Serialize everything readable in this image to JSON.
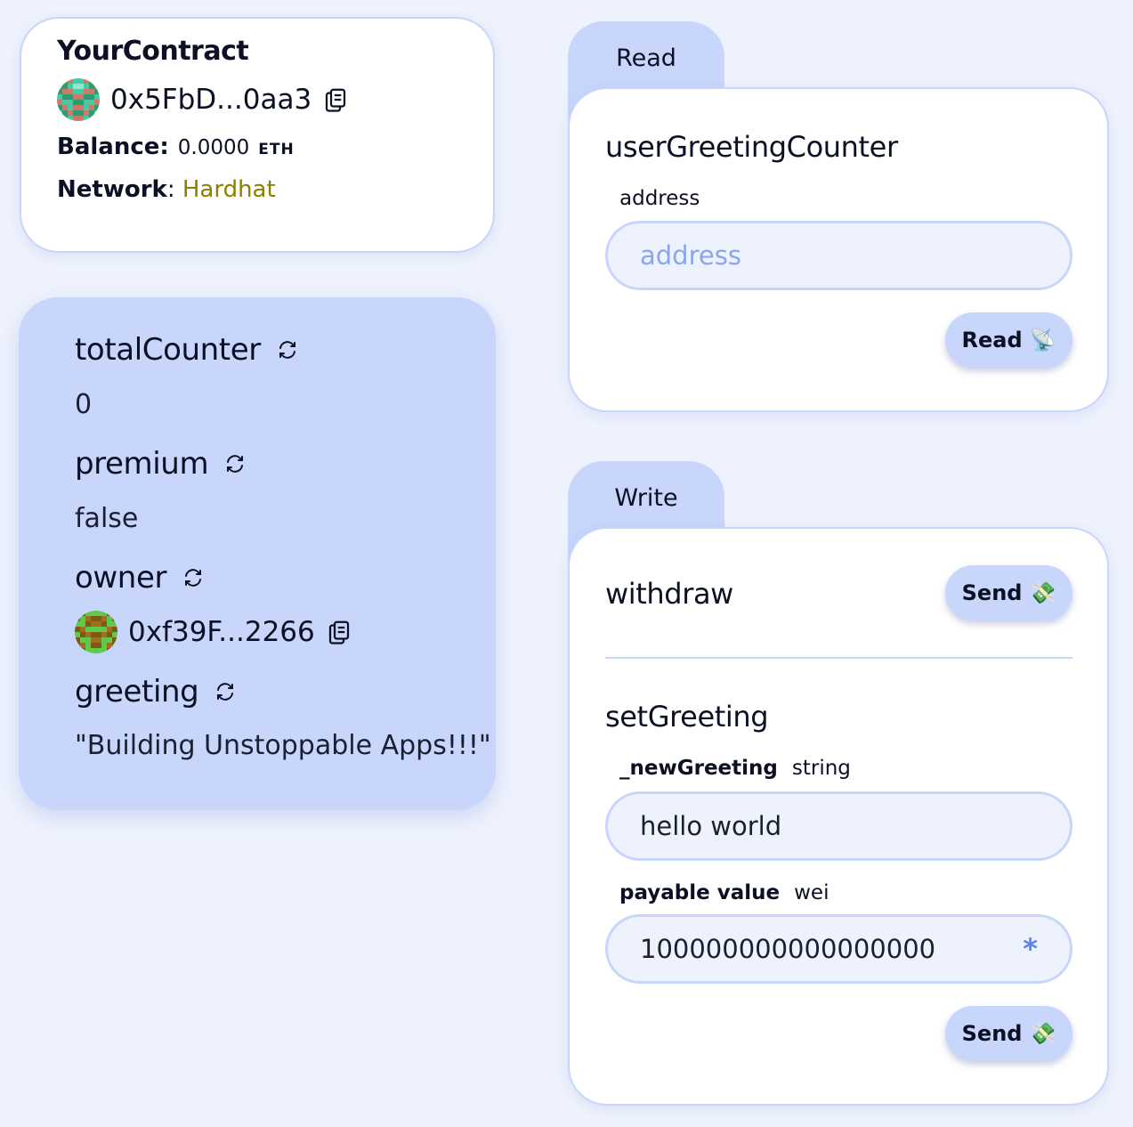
{
  "contract": {
    "name": "YourContract",
    "address": "0x5FbD...0aa3",
    "balance_label": "Balance:",
    "balance_value": "0.0000",
    "balance_unit": "ETH",
    "network_label": "Network",
    "network_value": "Hardhat"
  },
  "variables": [
    {
      "name": "totalCounter",
      "value": "0"
    },
    {
      "name": "premium",
      "value": "false"
    },
    {
      "name": "owner",
      "value": "0xf39F...2266"
    },
    {
      "name": "greeting",
      "value": "\"Building Unstoppable Apps!!!\""
    }
  ],
  "read": {
    "tab_label": "Read",
    "function_name": "userGreetingCounter",
    "param_label": "address",
    "input_placeholder": "address",
    "button_label": "Read",
    "button_emoji": "📡"
  },
  "write": {
    "tab_label": "Write",
    "withdraw": {
      "name": "withdraw",
      "button_label": "Send",
      "button_emoji": "💸"
    },
    "setGreeting": {
      "name": "setGreeting",
      "param_name": "_newGreeting",
      "param_type": "string",
      "param_value": "hello world",
      "payable_label": "payable value",
      "payable_unit": "wei",
      "payable_value": "100000000000000000",
      "multiply_symbol": "*",
      "button_label": "Send",
      "button_emoji": "💸"
    }
  },
  "icons": {
    "copy": "copy-icon",
    "refresh": "refresh-icon"
  },
  "colors": {
    "background": "#eef2fd",
    "accent": "#c8d6fb",
    "network": "#8b8000",
    "placeholder": "#8aa6ec"
  }
}
